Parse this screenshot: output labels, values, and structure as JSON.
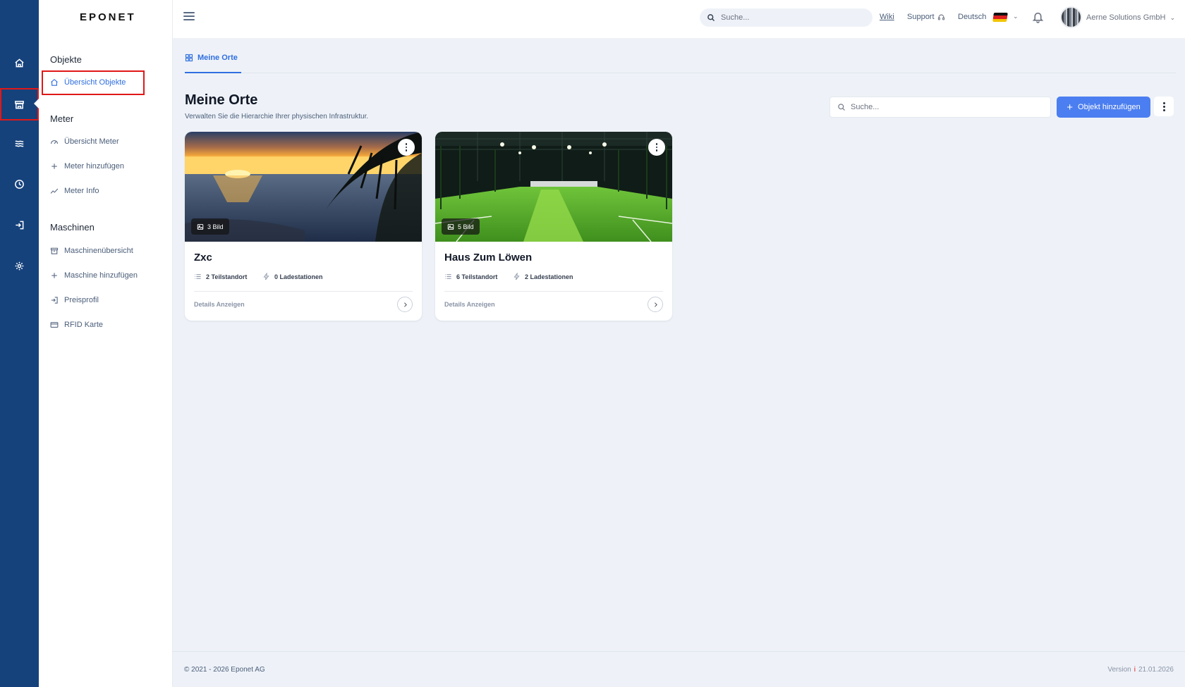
{
  "app": {
    "logo": "EPONET"
  },
  "rail": {
    "items": [
      {
        "icon": "home-icon"
      },
      {
        "icon": "store-icon",
        "active": true
      },
      {
        "icon": "waves-icon"
      },
      {
        "icon": "clock-icon"
      },
      {
        "icon": "login-icon"
      },
      {
        "icon": "gear-icon"
      }
    ]
  },
  "sidebar": {
    "sections": [
      {
        "title": "Objekte",
        "items": [
          {
            "label": "Übersicht Objekte",
            "icon": "home-icon",
            "active": true
          }
        ]
      },
      {
        "title": "Meter",
        "items": [
          {
            "label": "Übersicht Meter",
            "icon": "gauge-icon"
          },
          {
            "label": "Meter hinzufügen",
            "icon": "plus-icon"
          },
          {
            "label": "Meter Info",
            "icon": "trend-icon"
          }
        ]
      },
      {
        "title": "Maschinen",
        "items": [
          {
            "label": "Maschinenübersicht",
            "icon": "archive-icon"
          },
          {
            "label": "Maschine hinzufügen",
            "icon": "plus-icon"
          },
          {
            "label": "Preisprofil",
            "icon": "login-icon"
          },
          {
            "label": "RFID Karte",
            "icon": "card-icon"
          }
        ]
      }
    ]
  },
  "topbar": {
    "search_placeholder": "Suche...",
    "wiki": "Wiki",
    "support": "Support",
    "language": "Deutsch",
    "company": "Aerne Solutions GmbH"
  },
  "main": {
    "tab": "Meine Orte",
    "title": "Meine Orte",
    "subtitle": "Verwalten Sie die Hierarchie Ihrer physischen Infrastruktur.",
    "search_placeholder": "Suche...",
    "add_button": "Objekt hinzufügen",
    "cards": [
      {
        "name": "Zxc",
        "images": "3 Bild",
        "sublocations": "2 Teilstandort",
        "chargers": "0 Ladestationen",
        "details": "Details Anzeigen"
      },
      {
        "name": "Haus Zum Löwen",
        "images": "5 Bild",
        "sublocations": "6 Teilstandort",
        "chargers": "2 Ladestationen",
        "details": "Details Anzeigen"
      }
    ]
  },
  "footer": {
    "copyright": "© 2021 - 2026 Eponet AG",
    "version_label": "Version",
    "version_date": "21.01.2026"
  },
  "colors": {
    "rail": "#16427c",
    "accent": "#2f6fe0",
    "button": "#4b7ef0",
    "highlight": "#e01818"
  }
}
